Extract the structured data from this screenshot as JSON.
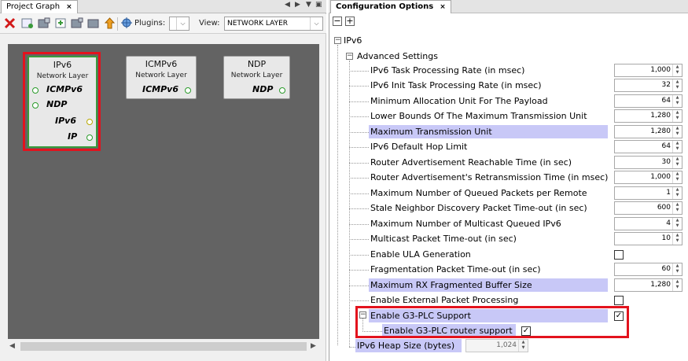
{
  "left_panel": {
    "tab_label": "Project Graph",
    "tab_close": "×",
    "plugins_label": "Plugins:",
    "plugins_value": "",
    "view_label": "View:",
    "view_value": "NETWORK LAYER",
    "nodes": [
      {
        "title": "IPv6",
        "subtitle": "Network Layer",
        "ports": [
          "ICMPv6",
          "NDP",
          "IPv6",
          "IP"
        ]
      },
      {
        "title": "ICMPv6",
        "subtitle": "Network Layer",
        "ports": [
          "ICMPv6"
        ]
      },
      {
        "title": "NDP",
        "subtitle": "Network Layer",
        "ports": [
          "NDP"
        ]
      }
    ]
  },
  "right_panel": {
    "tab_label": "Configuration Options",
    "tab_close": "×",
    "collapse_all": "−",
    "expand_all": "+",
    "root_label": "IPv6",
    "advanced_label": "Advanced Settings",
    "settings": [
      {
        "label": "IPv6 Task Processing Rate (in msec)",
        "value": "1,000"
      },
      {
        "label": "IPv6 Init Task Processing Rate (in msec)",
        "value": "32"
      },
      {
        "label": "Minimum Allocation Unit For The Payload",
        "value": "64"
      },
      {
        "label": "Lower Bounds Of The Maximum Transmission Unit",
        "value": "1,280"
      },
      {
        "label": "Maximum Transmission Unit",
        "value": "1,280"
      },
      {
        "label": "IPv6 Default Hop Limit",
        "value": "64"
      },
      {
        "label": "Router Advertisement Reachable Time (in sec)",
        "value": "30"
      },
      {
        "label": "Router Advertisement's Retransmission Time (in msec)",
        "value": "1,000"
      },
      {
        "label": "Maximum Number of Queued Packets per Remote",
        "value": "1"
      },
      {
        "label": "Stale Neighbor Discovery Packet Time-out (in sec)",
        "value": "600"
      },
      {
        "label": "Maximum Number of Multicast Queued IPv6",
        "value": "4"
      },
      {
        "label": "Multicast Packet Time-out (in sec)",
        "value": "10"
      },
      {
        "label": "Enable ULA Generation",
        "checked": false
      },
      {
        "label": "Fragmentation Packet Time-out (in sec)",
        "value": "60"
      },
      {
        "label": "Maximum RX Fragmented Buffer Size",
        "value": "1,280"
      },
      {
        "label": "Enable External Packet Processing",
        "checked": false
      },
      {
        "label": "Enable G3-PLC Support",
        "checked": true
      },
      {
        "label": "Enable G3-PLC router support",
        "checked": true
      }
    ],
    "heap_label": "IPv6 Heap Size (bytes)",
    "heap_value": "1,024",
    "check_mark": "✓"
  }
}
